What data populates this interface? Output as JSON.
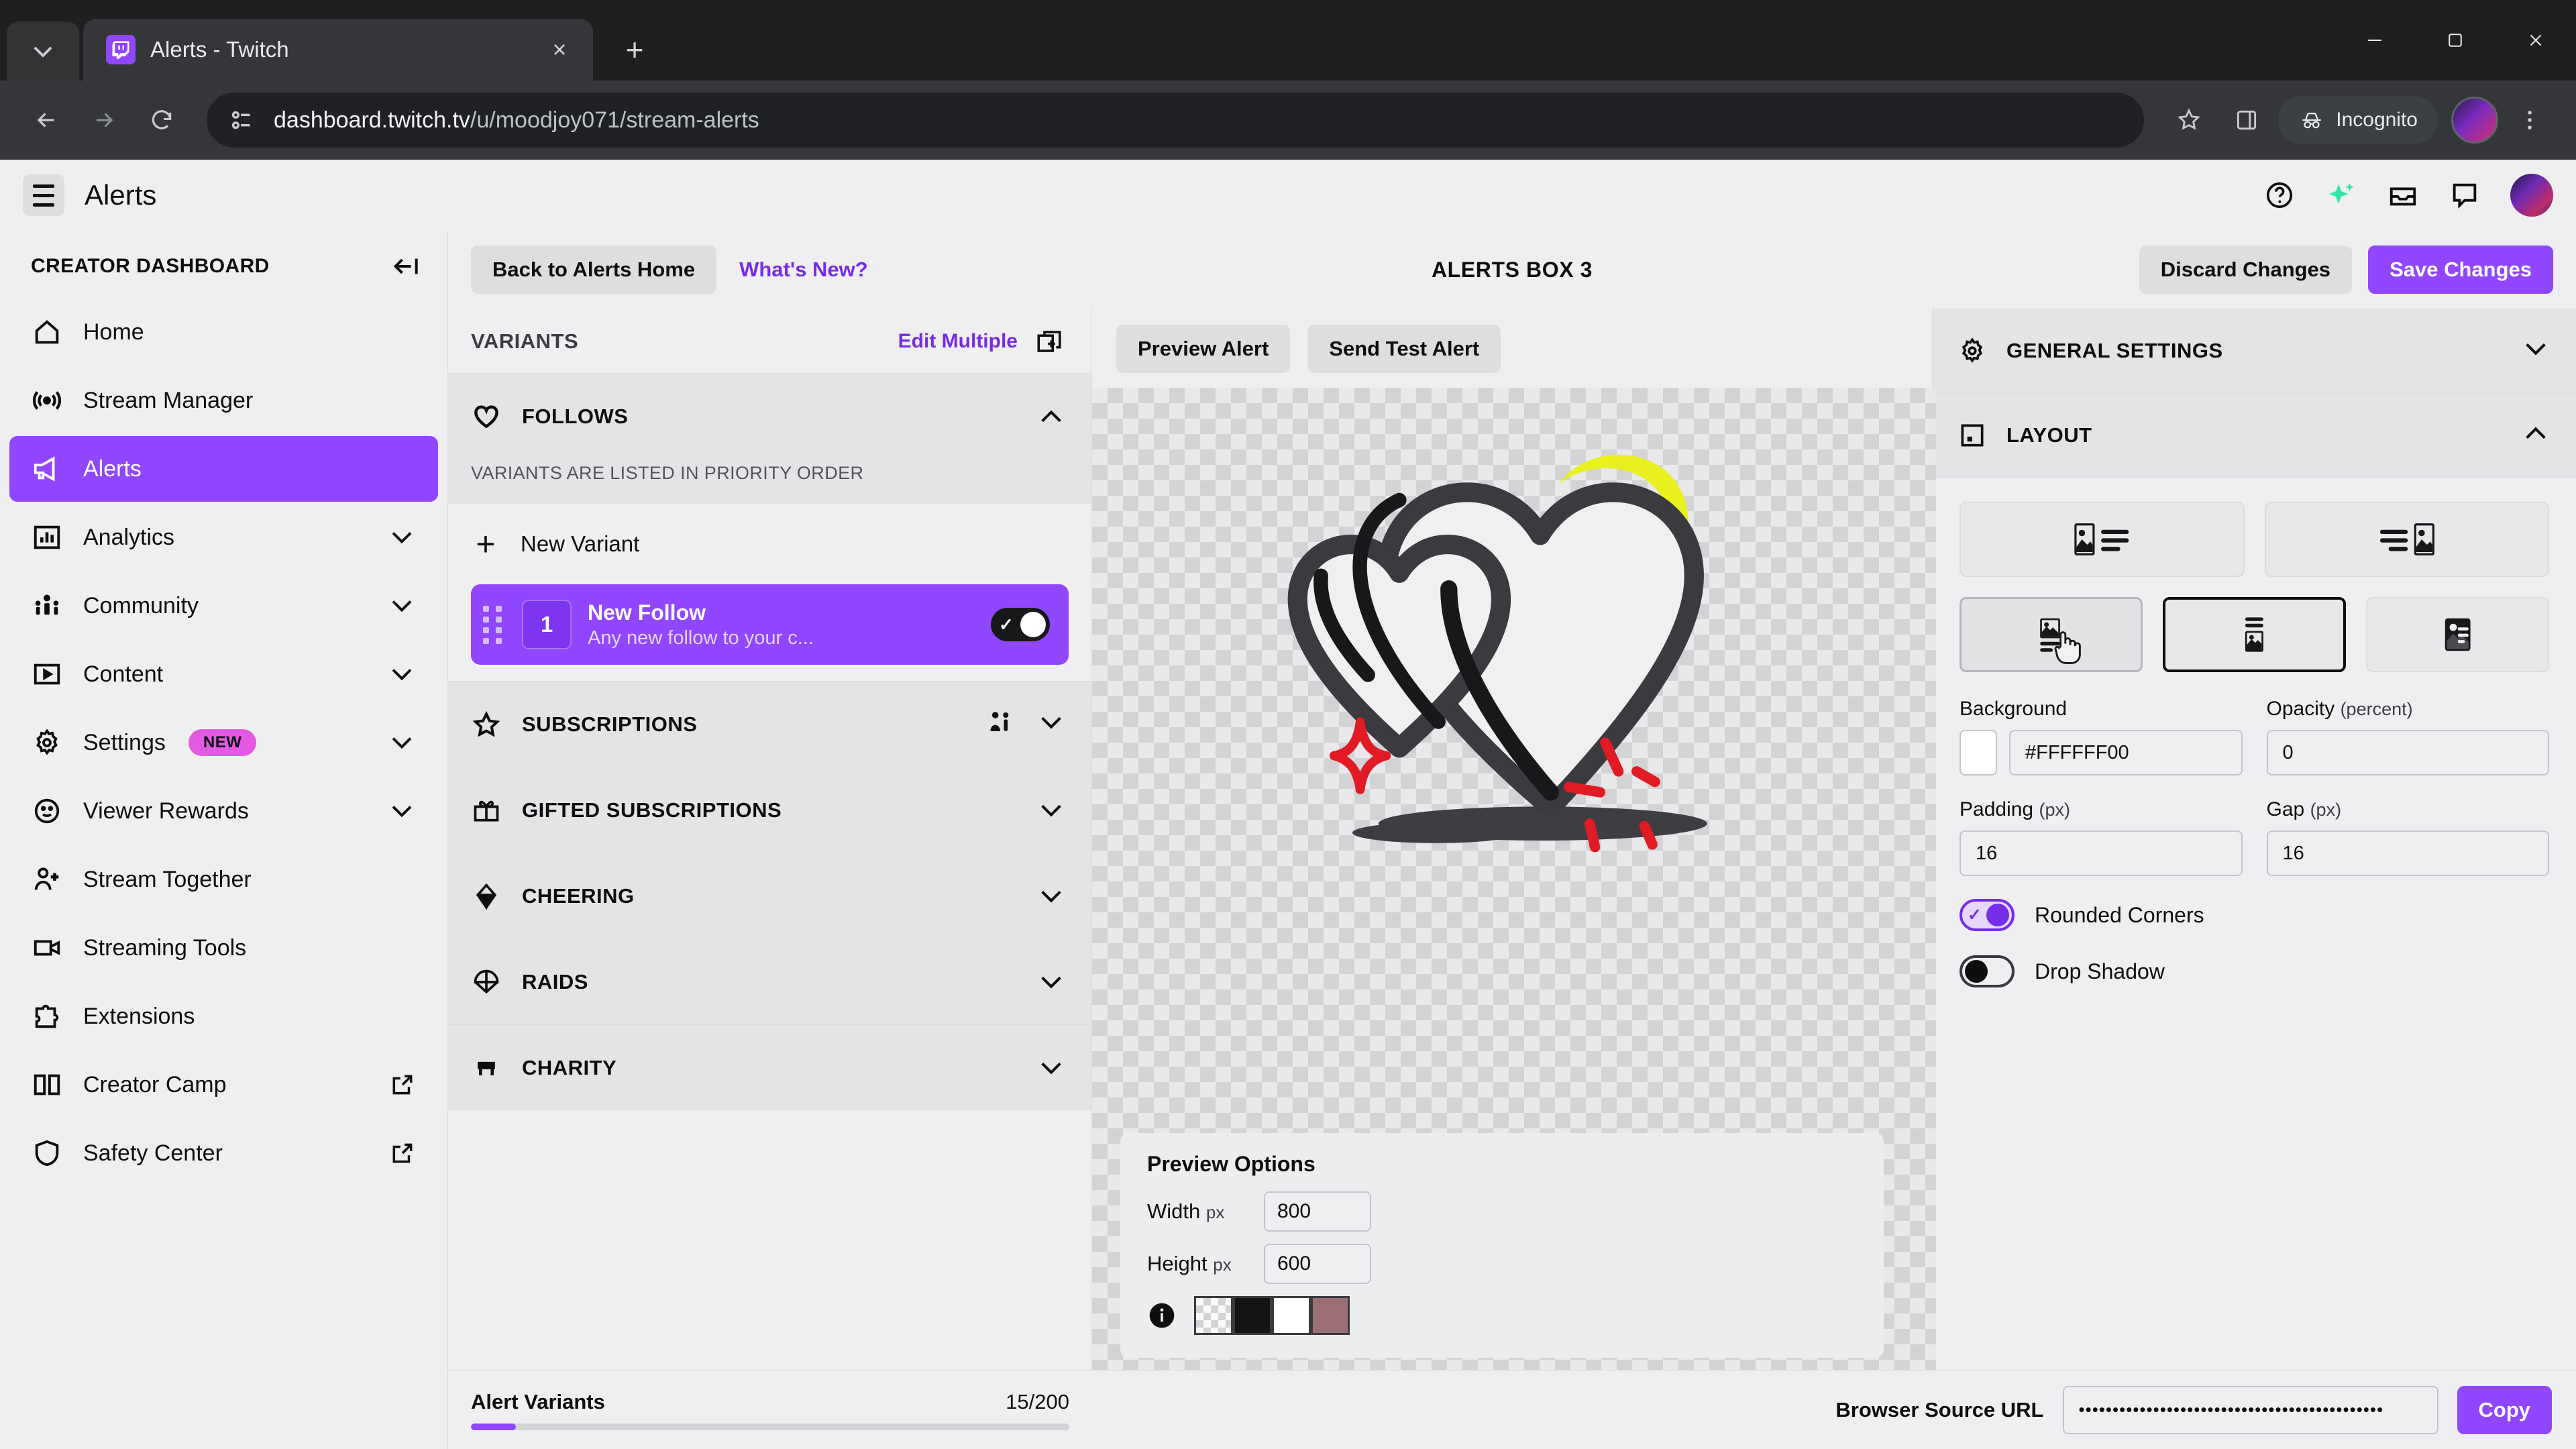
{
  "browser": {
    "tab": {
      "title": "Alerts - Twitch",
      "favicon": "twitch-icon",
      "close": "×"
    },
    "newtab_label": "+",
    "url_prefix": "dashboard.twitch.tv",
    "url_suffix": "/u/moodjoy071/stream-alerts",
    "incognito_label": "Incognito",
    "window": {
      "minimize": "minimize-icon",
      "maximize": "maximize-icon",
      "close": "close-icon"
    }
  },
  "app_header": {
    "title": "Alerts",
    "icons": [
      "help-icon",
      "ai-sparkle-icon",
      "inbox-icon",
      "chat-icon"
    ],
    "sparkle_color": "#2ee6a8"
  },
  "sidebar": {
    "heading": "CREATOR DASHBOARD",
    "items": [
      {
        "label": "Home",
        "icon": "home-icon"
      },
      {
        "label": "Stream Manager",
        "icon": "broadcast-icon"
      },
      {
        "label": "Alerts",
        "icon": "megaphone-icon",
        "active": true
      },
      {
        "label": "Analytics",
        "icon": "chart-icon",
        "chevron": true
      },
      {
        "label": "Community",
        "icon": "community-icon",
        "chevron": true
      },
      {
        "label": "Content",
        "icon": "video-frame-icon",
        "chevron": true
      },
      {
        "label": "Settings",
        "icon": "gear-icon",
        "badge": "NEW",
        "chevron": true
      },
      {
        "label": "Viewer Rewards",
        "icon": "smiley-icon",
        "chevron": true
      },
      {
        "label": "Stream Together",
        "icon": "person-plus-icon"
      },
      {
        "label": "Streaming Tools",
        "icon": "camcorder-icon"
      },
      {
        "label": "Extensions",
        "icon": "puzzle-icon"
      },
      {
        "label": "Creator Camp",
        "icon": "book-icon",
        "external": true
      },
      {
        "label": "Safety Center",
        "icon": "shield-icon",
        "external": true
      }
    ]
  },
  "action_bar": {
    "back_label": "Back to Alerts Home",
    "whats_new_label": "What's New?",
    "title": "ALERTS BOX 3",
    "discard_label": "Discard Changes",
    "save_label": "Save Changes",
    "accent": "#9147ff"
  },
  "variants": {
    "header": "VARIANTS",
    "edit_multiple": "Edit Multiple",
    "duplicate_icon": "duplicate-icon",
    "sections": [
      {
        "label": "FOLLOWS",
        "icon": "heart-icon",
        "expanded": true,
        "note": "VARIANTS ARE LISTED IN PRIORITY ORDER",
        "new_variant_label": "New Variant",
        "items": [
          {
            "number": "1",
            "name": "New Follow",
            "desc": "Any new follow to your c...",
            "enabled": true
          }
        ]
      },
      {
        "label": "SUBSCRIPTIONS",
        "icon": "star-icon",
        "expanded": false,
        "extra_icon": "persons-icon"
      },
      {
        "label": "GIFTED SUBSCRIPTIONS",
        "icon": "gift-icon",
        "expanded": false
      },
      {
        "label": "CHEERING",
        "icon": "bits-icon",
        "expanded": false
      },
      {
        "label": "RAIDS",
        "icon": "parachute-icon",
        "expanded": false
      },
      {
        "label": "CHARITY",
        "icon": "charity-icon",
        "expanded": false
      }
    ]
  },
  "preview": {
    "preview_alert_label": "Preview Alert",
    "send_test_label": "Send Test Alert",
    "options": {
      "title": "Preview Options",
      "width_label": "Width",
      "width_unit": "px",
      "width_value": "800",
      "height_label": "Height",
      "height_unit": "px",
      "height_value": "600",
      "info_icon": "info-icon",
      "swatches": [
        "transparent",
        "#141414",
        "#ffffff",
        "#9b6f75"
      ]
    }
  },
  "settings": {
    "general": {
      "label": "GENERAL SETTINGS",
      "icon": "gear-icon",
      "expanded": false
    },
    "layout": {
      "label": "LAYOUT",
      "icon": "layout-icon",
      "expanded": true,
      "options_row1": [
        {
          "name": "image-left-text-right",
          "selected": false
        },
        {
          "name": "text-left-image-right",
          "selected": false
        }
      ],
      "options_row2": [
        {
          "name": "image-top-text-bottom",
          "selected": false,
          "hovered": true
        },
        {
          "name": "text-top-image-bottom",
          "selected": true
        },
        {
          "name": "text-over-image",
          "selected": false
        }
      ],
      "background_label": "Background",
      "background_value": "#FFFFFF00",
      "opacity_label": "Opacity",
      "opacity_unit": "(percent)",
      "opacity_value": "0",
      "padding_label": "Padding",
      "padding_unit": "(px)",
      "padding_value": "16",
      "gap_label": "Gap",
      "gap_unit": "(px)",
      "gap_value": "16",
      "rounded_corners_label": "Rounded Corners",
      "rounded_corners_on": true,
      "drop_shadow_label": "Drop Shadow",
      "drop_shadow_on": false
    }
  },
  "bottom_bar": {
    "alert_variants_label": "Alert Variants",
    "alert_variants_count": "15/200",
    "progress_percent": 7.5,
    "browser_source_label": "Browser Source URL",
    "browser_source_value": "•••••••••••••••••••••••••••••••••••••••••••••",
    "copy_label": "Copy"
  }
}
